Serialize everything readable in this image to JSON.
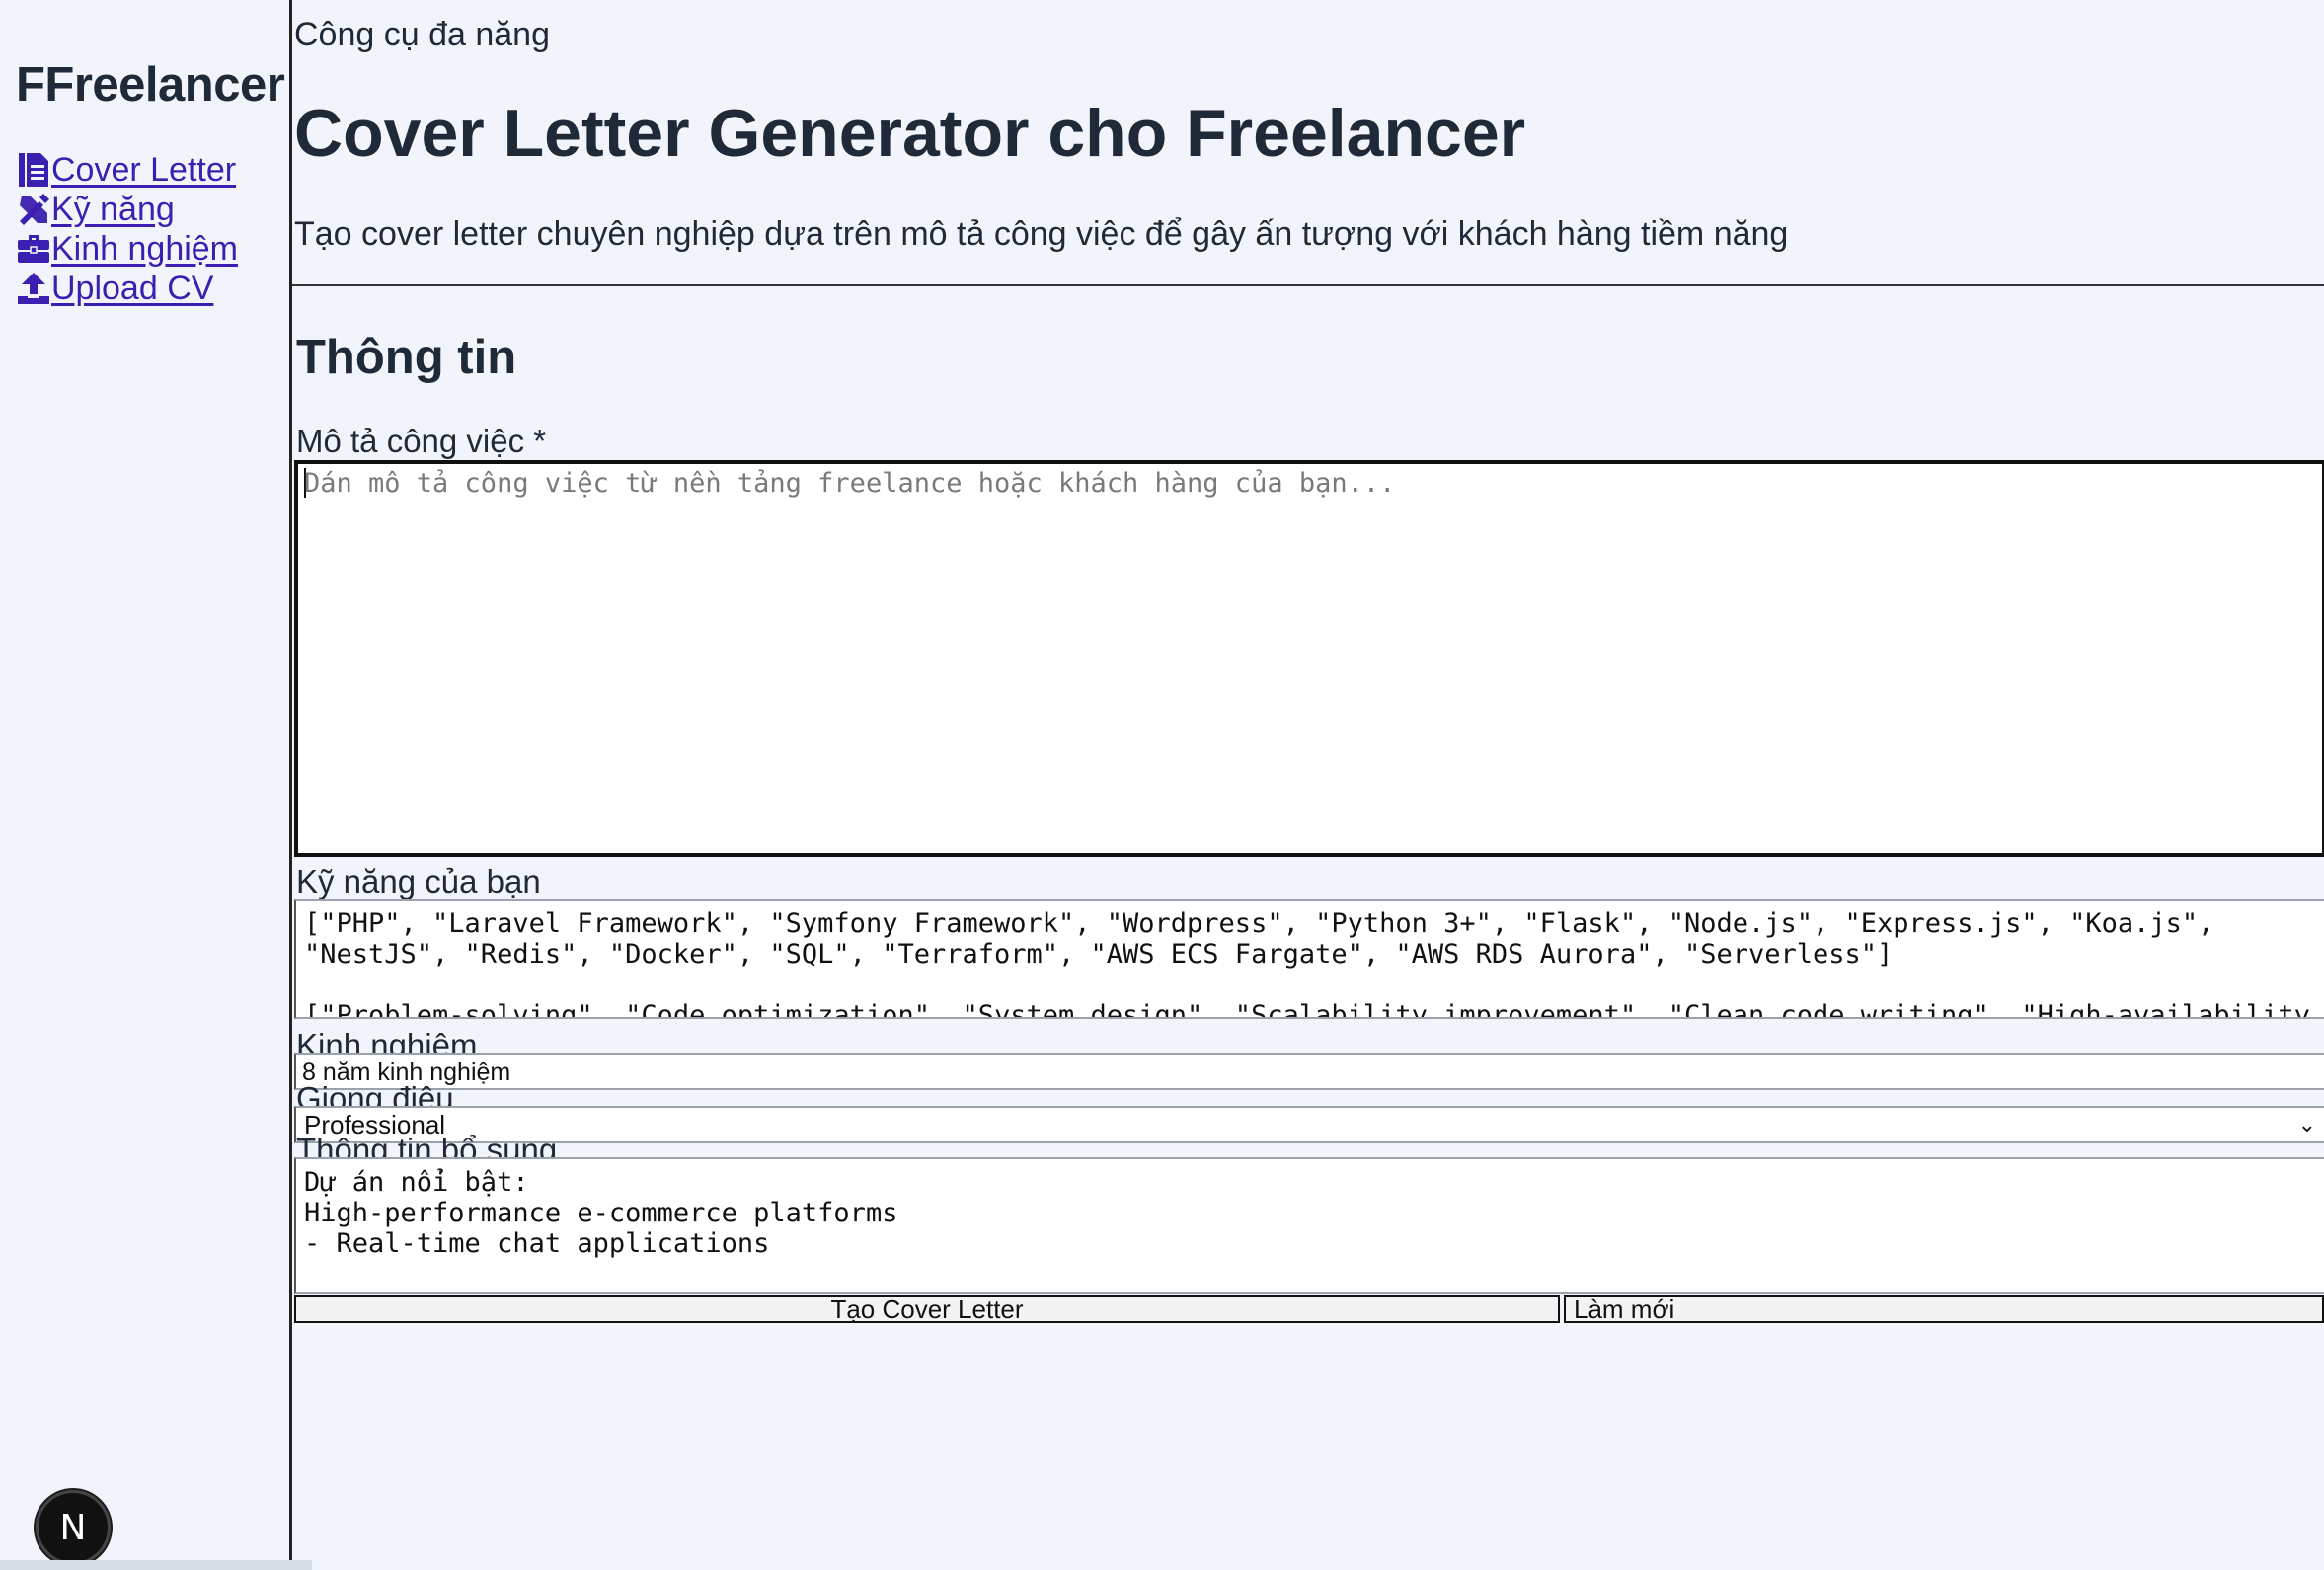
{
  "sidebar": {
    "brand": "FFreelancer",
    "items": [
      {
        "label": "Cover Letter",
        "icon": "file-document-icon"
      },
      {
        "label": "Kỹ năng",
        "icon": "tools-icon"
      },
      {
        "label": "Kinh nghiệm",
        "icon": "briefcase-icon"
      },
      {
        "label": "Upload CV",
        "icon": "upload-icon"
      }
    ],
    "badge": "N"
  },
  "header": {
    "eyebrow": "Công cụ đa năng",
    "title": "Cover Letter Generator cho Freelancer",
    "subtitle": "Tạo cover letter chuyên nghiệp dựa trên mô tả công việc để gây ấn tượng với khách hàng tiềm năng"
  },
  "form": {
    "section_title": "Thông tin",
    "job_label": "Mô tả công việc *",
    "job_placeholder": "Dán mô tả công việc từ nền tảng freelance hoặc khách hàng của bạn...",
    "skills_label": "Kỹ năng của bạn",
    "skills_value": "[\"PHP\", \"Laravel Framework\", \"Symfony Framework\", \"Wordpress\", \"Python 3+\", \"Flask\", \"Node.js\", \"Express.js\", \"Koa.js\",\n\"NestJS\", \"Redis\", \"Docker\", \"SQL\", \"Terraform\", \"AWS ECS Fargate\", \"AWS RDS Aurora\", \"Serverless\"]\n\n[\"Problem-solving\", \"Code optimization\", \"System design\", \"Scalability improvement\", \"Clean code writing\", \"High-availability\nsystem building\"]",
    "experience_label": "Kinh nghiệm",
    "experience_value": "8 năm kinh nghiệm",
    "tone_label": "Giọng điệu",
    "tone_value": "Professional",
    "extra_label": "Thông tin bổ sung",
    "extra_value": "Dự án nổi bật:\nHigh-performance e-commerce platforms\n- Real-time chat applications",
    "submit_label": "Tạo Cover Letter",
    "reset_label": "Làm mới"
  },
  "colors": {
    "background": "#f1f5fb",
    "link": "#3b1fb0",
    "text": "#1f2937"
  }
}
